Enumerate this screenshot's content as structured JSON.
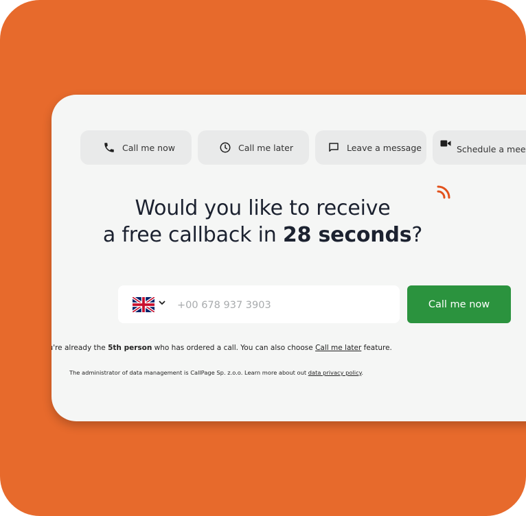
{
  "colors": {
    "background": "#e76a2c",
    "card": "#f5f6f5",
    "tab": "#e9eaea",
    "primary_button": "#2b933e",
    "wifi_accent": "#e2521c",
    "headline_text": "#1c2230"
  },
  "tabs": [
    {
      "label": "Call me now",
      "icon": "phone-icon"
    },
    {
      "label": "Call me later",
      "icon": "clock-icon"
    },
    {
      "label": "Leave a message",
      "icon": "message-icon"
    },
    {
      "label": "Schedule a meetin",
      "icon": "video-camera-icon"
    }
  ],
  "headline": {
    "line1": "Would you like to receive",
    "line2_prefix": "a free callback in ",
    "line2_bold": "28 seconds",
    "line2_suffix": "?"
  },
  "phone": {
    "country_icon": "uk-flag-icon",
    "placeholder": "+00 678 937 3903"
  },
  "submit_label": "Call me now",
  "notice": {
    "prefix": "You're already the ",
    "bold": "5th person",
    "middle": " who has ordered a call. You can also choose ",
    "link": "Call me later",
    "suffix": " feature."
  },
  "privacy": {
    "text": "The administrator of data management is CallPage Sp. z.o.o. Learn more about out ",
    "link": "data privacy policy",
    "suffix": "."
  }
}
